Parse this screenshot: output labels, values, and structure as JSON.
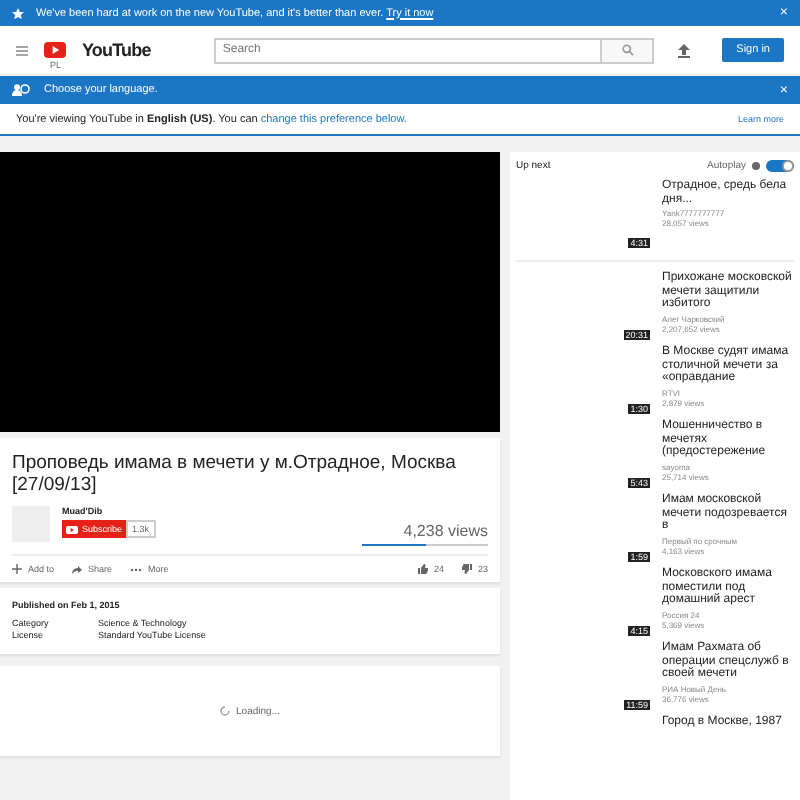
{
  "promo_banner": {
    "text": "We've been hard at work on the new YouTube, and it's better than ever.",
    "link": "Try it now",
    "close": "×"
  },
  "header": {
    "logo": "YouTube",
    "country": "PL",
    "search": {
      "placeholder": "Search"
    },
    "sign_in": "Sign in"
  },
  "language_bar": {
    "title": "Choose your language.",
    "close": "×",
    "notice": "You're viewing YouTube in **English (US)**. You can",
    "notice_link": "change this preference below.",
    "learn_more": "Learn more"
  },
  "video": {
    "title": "Проповедь имама в мечети у м.Отрадное, Москва [27/09/13]",
    "channel": "Muad'Dib",
    "subscribe": "Subscribe",
    "subscribers": "1.3k",
    "views": "4,238 views",
    "like_ratio": {
      "level": 0.5
    },
    "actions": [
      "Add to",
      "Share",
      "More"
    ],
    "likes": "24",
    "dislikes": "23"
  },
  "details": {
    "published": "Published on Feb 1, 2015",
    "rows": [
      {
        "label": "Category",
        "value": "Science & Technology"
      },
      {
        "label": "License",
        "value": "Standard YouTube License"
      }
    ]
  },
  "comments": {
    "loading": "Loading..."
  },
  "up_next": {
    "title": "Up next",
    "autoplay": {
      "label": "Autoplay",
      "on": true
    },
    "items": [
      {
        "title": "Отрадное, средь бела дня...",
        "channel": "Yank7777777777",
        "views": "28,057 views",
        "duration": "4:31"
      },
      {
        "title": "Прихожане московской мечети защитили избитого",
        "channel": "Алег Чарковский",
        "views": "2,207,652 views",
        "duration": "20:31"
      },
      {
        "title": "В Москве судят имама столичной мечети за «оправдание",
        "channel": "RTVI",
        "views": "2,879 views",
        "duration": "1:30"
      },
      {
        "title": "Мошенничество в мечетях (предостережение",
        "channel": "sayoma",
        "views": "25,714 views",
        "duration": "5:43"
      },
      {
        "title": "Имам московской мечети подозревается в",
        "channel": "Первый по срочным",
        "views": "4,163 views",
        "duration": "1:59"
      },
      {
        "title": "Московского имама поместили под домашний арест",
        "channel": "Россия 24",
        "views": "5,369 views",
        "duration": "4:15"
      },
      {
        "title": "Имам Рахмата об операции спецслужб в своей мечети",
        "channel": "РИА Новый День",
        "views": "36,776 views",
        "duration": "11:59"
      },
      {
        "title": "Город в Москве, 1987"
      }
    ]
  }
}
